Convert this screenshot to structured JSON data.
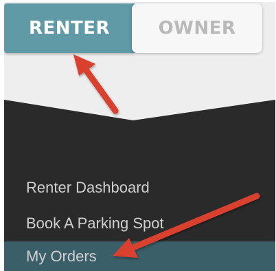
{
  "toggle": {
    "renter_label": "RENTER",
    "owner_label": "OWNER",
    "active": "RENTER"
  },
  "menu": {
    "items": [
      {
        "label": "Renter Dashboard"
      },
      {
        "label": "Book A Parking Spot"
      },
      {
        "label": "My Orders"
      }
    ],
    "active_item": "My Orders"
  },
  "colors": {
    "accent": "#5f9aa6",
    "panel": "#2a2a2a",
    "active_row": "#3a5f68",
    "annotation_arrow": "#d9412f"
  }
}
